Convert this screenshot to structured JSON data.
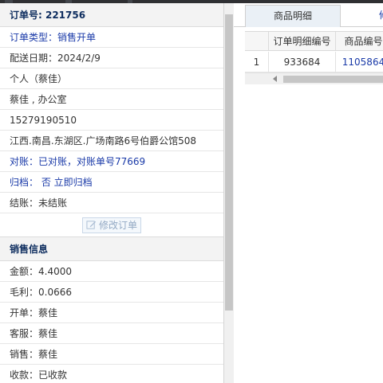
{
  "order": {
    "number_label": "订单号: 221756",
    "fields": [
      {
        "text": "订单类型：销售开单",
        "style": "link"
      },
      {
        "text": "配送日期：2024/2/9",
        "style": "plain"
      },
      {
        "text": "个人（蔡佳）",
        "style": "plain"
      },
      {
        "text": "蔡佳 , 办公室",
        "style": "plain"
      },
      {
        "text": "15279190510",
        "style": "plain"
      },
      {
        "text": "江西.南昌.东湖区.广场南路6号伯爵公馆508",
        "style": "plain"
      },
      {
        "text": "对账：已对账，对账单号77669",
        "style": "link"
      },
      {
        "text": "归档： 否 立即归档",
        "style": "link"
      },
      {
        "text": "结账：未结账",
        "style": "plain"
      }
    ],
    "edit_button": "修改订单"
  },
  "sales": {
    "title": "销售信息",
    "fields": [
      "金额：4.4000",
      "毛利：0.0666",
      "开单：蔡佳",
      "客服：蔡佳",
      "销售：蔡佳",
      "收款：已收款"
    ]
  },
  "tabs": [
    {
      "label": "商品明细",
      "active": true
    },
    {
      "label": "修",
      "active": false
    }
  ],
  "grid": {
    "headers": [
      "订单明细编号",
      "商品编号"
    ],
    "rows": [
      {
        "index": "1",
        "detail_id": "933684",
        "product_id": "1105864"
      }
    ]
  },
  "colors": {
    "accent_text": "#1a3aa8",
    "header_text": "#0e2d5f"
  }
}
